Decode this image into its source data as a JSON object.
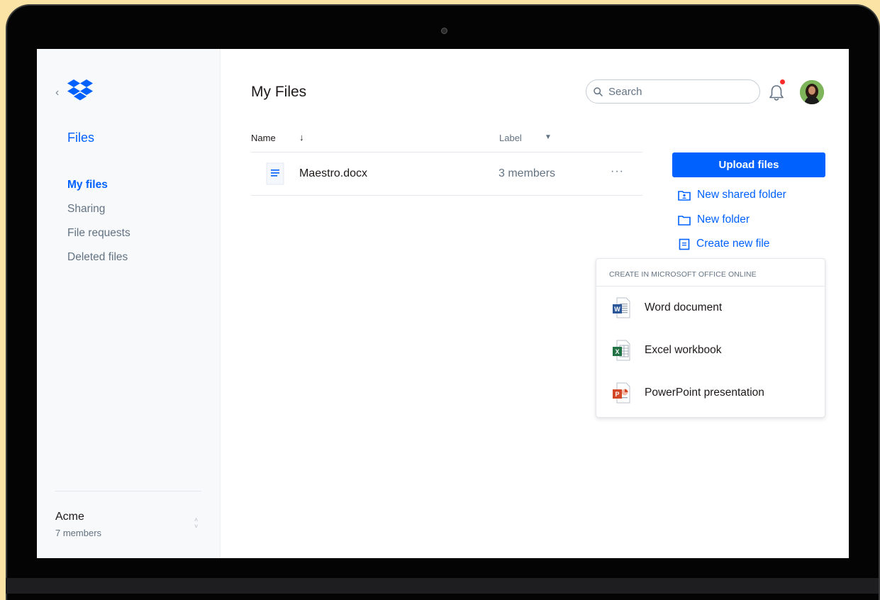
{
  "sidebar": {
    "title": "Files",
    "items": [
      {
        "label": "My files",
        "active": true
      },
      {
        "label": "Sharing",
        "active": false
      },
      {
        "label": "File requests",
        "active": false
      },
      {
        "label": "Deleted files",
        "active": false
      }
    ],
    "team": {
      "name": "Acme",
      "members": "7 members"
    }
  },
  "header": {
    "title": "My Files",
    "search_placeholder": "Search"
  },
  "table": {
    "columns": {
      "name": "Name",
      "label": "Label"
    },
    "rows": [
      {
        "name": "Maestro.docx",
        "label": "3 members",
        "more": "···"
      }
    ]
  },
  "actions": {
    "upload_label": "Upload files",
    "new_shared_folder": "New shared folder",
    "new_folder": "New folder",
    "create_new_file": "Create new file"
  },
  "dropdown": {
    "header": "CREATE IN MICROSOFT OFFICE ONLINE",
    "items": [
      {
        "label": "Word document",
        "icon": "word-icon"
      },
      {
        "label": "Excel workbook",
        "icon": "excel-icon"
      },
      {
        "label": "PowerPoint presentation",
        "icon": "powerpoint-icon"
      }
    ]
  },
  "colors": {
    "accent": "#0061fe",
    "background": "#fbe3a5",
    "notification": "#ff2b2b"
  }
}
